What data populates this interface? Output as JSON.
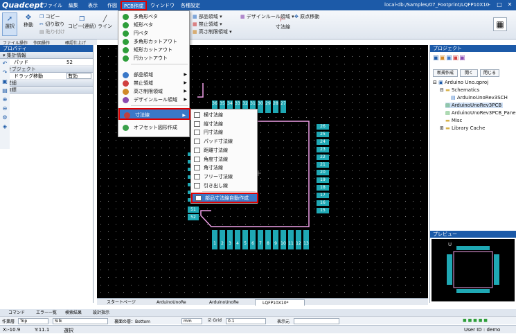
{
  "app": {
    "logo": "Quadcept",
    "title": "local-db:/Samples/07_Footprint/LQFP10X10"
  },
  "menubar": {
    "items": [
      "ファイル",
      "編集",
      "表示",
      "作図",
      "PCB作成",
      "ウィンドウ",
      "各種設定"
    ]
  },
  "ribbon": {
    "select": "選択",
    "move": "移動",
    "copy": "コピー",
    "cut": "切り取り",
    "paste": "貼り付け",
    "copy_cont": "コピー(連続)",
    "line": "ライン",
    "comp_area": "部品領域",
    "forbid_area": "禁止領域",
    "height_area": "高さ制限領域",
    "design_rule_area": "デザインルール領域",
    "origin_move": "原点移動",
    "dimension": "寸法線"
  },
  "group_labels": [
    "ファイル操作",
    "作図操作",
    "確認仕上げ"
  ],
  "properties": {
    "title": "プロパティ",
    "aggregate": "集計情報",
    "pad_label": "パッド",
    "pad_value": "52",
    "object": "オブジェクト",
    "drag_label": "ドラッグ移動",
    "drag_value": "有効",
    "detail": "詳細",
    "coords": "座標"
  },
  "pcb_menu": {
    "items": [
      "多角形ベタ",
      "矩形ベタ",
      "円ベタ",
      "多角形カットアウト",
      "矩形カットアウト",
      "円カットアウト",
      "部品領域",
      "禁止領域",
      "高さ制限領域",
      "デザインルール領域",
      "寸法線",
      "オフセット図形作成"
    ],
    "colors": [
      "#2e9e3a",
      "#2e9e3a",
      "#2e9e3a",
      "#2e9e3a",
      "#2e9e3a",
      "#2e9e3a",
      "#3a78c8",
      "#d04040",
      "#d08a2a",
      "#8a4ab0",
      "#c04040",
      "#3aa04a"
    ]
  },
  "dim_submenu": {
    "items": [
      "横寸法線",
      "縦寸法線",
      "円寸法線",
      "パッド寸法線",
      "距離寸法線",
      "角度寸法線",
      "角寸法線",
      "フリー寸法線",
      "引き出し線"
    ],
    "auto": "部品寸法線自動作成"
  },
  "canvas": {
    "top_pads": [
      "36",
      "35",
      "34",
      "33",
      "32",
      "31",
      "30",
      "29",
      "28",
      "27"
    ],
    "right_pads": [
      "26",
      "25",
      "24",
      "23",
      "22",
      "21",
      "20",
      "19",
      "18",
      "17",
      "16",
      "15"
    ],
    "bottom_pads": [
      "1",
      "2",
      "3",
      "4",
      "5",
      "6",
      "7",
      "8",
      "9",
      "10",
      "11",
      "12",
      "13"
    ],
    "left_pads_visible": [
      "51",
      "52"
    ]
  },
  "project": {
    "title": "プロジェクト",
    "btn_new": "新規作成",
    "btn_open": "開く",
    "btn_close": "閉じる",
    "tree": [
      "Arduino Uno.qproj",
      "Schematics",
      "ArduinoUnoRev3SCH",
      "ArduinoUnoRev3PCB",
      "ArduinoUnoRev3PCB_Panel",
      "Misc",
      "Library Cache"
    ]
  },
  "preview": {
    "title": "プレビュー"
  },
  "doc_tabs": [
    "スタートページ",
    "ArduinoUnoRe",
    "ArduinoUnoRe",
    "LQFP10X10*"
  ],
  "bottom_tabs": [
    "コマンド",
    "エラー一覧",
    "検索結果",
    "設計指示"
  ],
  "options": {
    "layer_label": "作業層",
    "layer_value": "Top",
    "silk": "Silk",
    "face_label": "裏面の層：Bottom",
    "unit": "mm",
    "grid_label": "Grid",
    "grid_value": "0.1",
    "display_label": "表示元"
  },
  "status": {
    "x": "X:-10.9",
    "y": "Y:11.1",
    "mode": "選択",
    "user": "User ID : demo"
  }
}
